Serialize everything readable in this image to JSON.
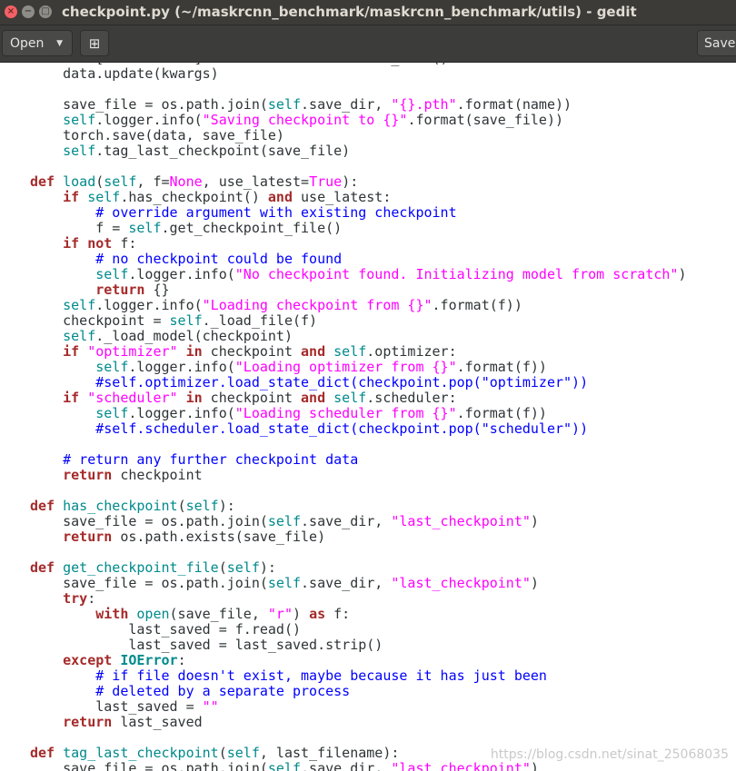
{
  "window": {
    "title": "checkpoint.py (~/maskrcnn_benchmark/maskrcnn_benchmark/utils) - gedit",
    "close_glyph": "×",
    "minimize_glyph": "−",
    "maximize_glyph": "□"
  },
  "toolbar": {
    "open_label": "Open",
    "open_arrow": "▼",
    "new_tab_glyph": "⊞",
    "save_label": "Save"
  },
  "editor": {
    "language": "python",
    "lines": [
      "    data[\"scheduler\"] = self.scheduler.state_dict()",
      "    data.update(kwargs)",
      "",
      "    save_file = os.path.join(self.save_dir, \"{}.pth\".format(name))",
      "    self.logger.info(\"Saving checkpoint to {}\".format(save_file))",
      "    torch.save(data, save_file)",
      "    self.tag_last_checkpoint(save_file)",
      "",
      "def load(self, f=None, use_latest=True):",
      "    if self.has_checkpoint() and use_latest:",
      "        # override argument with existing checkpoint",
      "        f = self.get_checkpoint_file()",
      "    if not f:",
      "        # no checkpoint could be found",
      "        self.logger.info(\"No checkpoint found. Initializing model from scratch\")",
      "        return {}",
      "    self.logger.info(\"Loading checkpoint from {}\".format(f))",
      "    checkpoint = self._load_file(f)",
      "    self._load_model(checkpoint)",
      "    if \"optimizer\" in checkpoint and self.optimizer:",
      "        self.logger.info(\"Loading optimizer from {}\".format(f))",
      "        #self.optimizer.load_state_dict(checkpoint.pop(\"optimizer\"))",
      "    if \"scheduler\" in checkpoint and self.scheduler:",
      "        self.logger.info(\"Loading scheduler from {}\".format(f))",
      "        #self.scheduler.load_state_dict(checkpoint.pop(\"scheduler\"))",
      "",
      "    # return any further checkpoint data",
      "    return checkpoint",
      "",
      "def has_checkpoint(self):",
      "    save_file = os.path.join(self.save_dir, \"last_checkpoint\")",
      "    return os.path.exists(save_file)",
      "",
      "def get_checkpoint_file(self):",
      "    save_file = os.path.join(self.save_dir, \"last_checkpoint\")",
      "    try:",
      "        with open(save_file, \"r\") as f:",
      "            last_saved = f.read()",
      "            last_saved = last_saved.strip()",
      "    except IOError:",
      "        # if file doesn't exist, maybe because it has just been",
      "        # deleted by a separate process",
      "        last_saved = \"\"",
      "    return last_saved",
      "",
      "def tag_last_checkpoint(self, last_filename):",
      "    save_file = os.path.join(self.save_dir, \"last_checkpoint\")"
    ]
  },
  "watermark": "https://blog.csdn.net/sinat_25068035",
  "colors": {
    "titlebar": "#3c3b37",
    "toolbar": "#3c3c3b",
    "keyword": "#a52a2a",
    "self": "#008a8c",
    "string": "#ff00ff",
    "comment": "#0000ff"
  }
}
